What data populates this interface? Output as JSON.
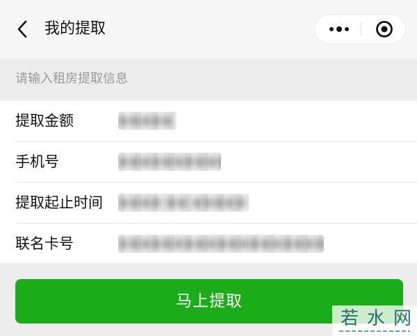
{
  "nav": {
    "title": "我的提取",
    "back_icon": "chevron-left-icon",
    "more_icon": "more-dots-icon",
    "close_icon": "target-close-icon"
  },
  "form": {
    "hint": "请输入租房提取信息",
    "fields": [
      {
        "label": "提取金额",
        "value": "●●●●●"
      },
      {
        "label": "手机号",
        "value": "●●●●●●●●●●●"
      },
      {
        "label": "提取起止时间",
        "value": "●●●● ●● ●●●●●"
      },
      {
        "label": "联名卡号",
        "value": "●●●●●●●●●●●●●●●●●●●●●●"
      }
    ]
  },
  "submit": {
    "label": "马上提取"
  },
  "watermark": {
    "text": "若水网"
  },
  "colors": {
    "primary_green": "#1aad19",
    "background": "#ededed",
    "hint_text": "#999999"
  }
}
